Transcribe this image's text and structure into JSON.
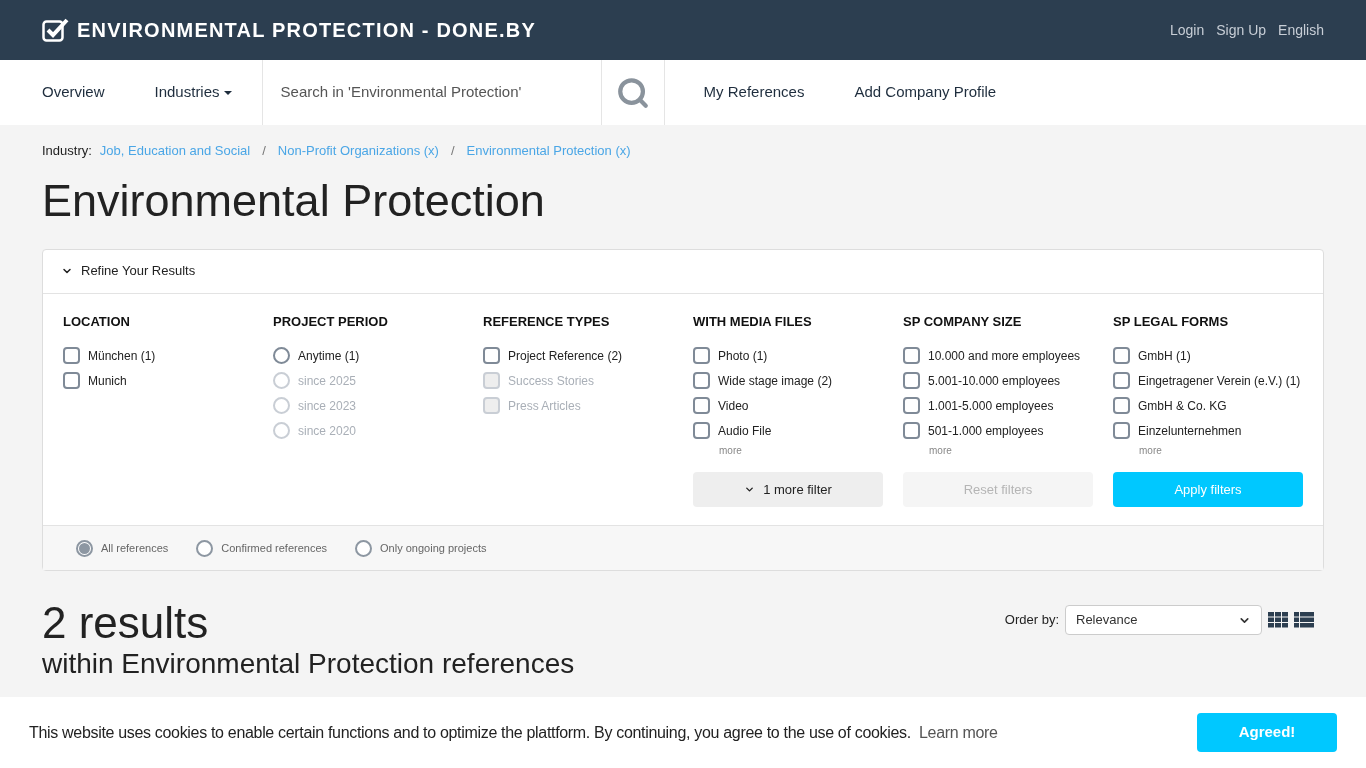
{
  "header": {
    "title": "ENVIRONMENTAL PROTECTION - DONE.BY",
    "links": [
      "Login",
      "Sign Up",
      "English"
    ]
  },
  "nav": {
    "items": [
      {
        "label": "Overview",
        "dropdown": false
      },
      {
        "label": "Industries",
        "dropdown": true
      }
    ],
    "search": {
      "placeholder": "Search in 'Environmental Protection'"
    },
    "links": [
      "My References",
      "Add Company Profile"
    ]
  },
  "breadcrumb": {
    "label": "Industry:",
    "separator": "/",
    "items": [
      "Job, Education and Social",
      "Non-Profit Organizations (x)",
      "Environmental Protection (x)"
    ]
  },
  "page_title": "Environmental Protection",
  "refine": {
    "title": "Refine Your Results",
    "expanded": true,
    "groups": [
      {
        "title": "LOCATION",
        "kind": "checkbox",
        "options": [
          {
            "label": "München (1)",
            "checked": false,
            "disabled": false
          },
          {
            "label": "Munich",
            "checked": false,
            "disabled": false
          }
        ]
      },
      {
        "title": "PROJECT PERIOD",
        "kind": "radio",
        "options": [
          {
            "label": "Anytime (1)",
            "checked": false,
            "disabled": false
          },
          {
            "label": "since 2025",
            "checked": false,
            "disabled": true
          },
          {
            "label": "since 2023",
            "checked": false,
            "disabled": true
          },
          {
            "label": "since 2020",
            "checked": false,
            "disabled": true
          }
        ]
      },
      {
        "title": "REFERENCE TYPES",
        "kind": "checkbox",
        "options": [
          {
            "label": "Project Reference (2)",
            "checked": false,
            "disabled": false
          },
          {
            "label": "Success Stories",
            "checked": false,
            "disabled": true
          },
          {
            "label": "Press Articles",
            "checked": false,
            "disabled": true
          }
        ]
      },
      {
        "title": "WITH MEDIA FILES",
        "kind": "checkbox",
        "more": "more",
        "options": [
          {
            "label": "Photo (1)",
            "checked": false,
            "disabled": false
          },
          {
            "label": "Wide stage image (2)",
            "checked": false,
            "disabled": false
          },
          {
            "label": "Video",
            "checked": false,
            "disabled": false
          },
          {
            "label": "Audio File",
            "checked": false,
            "disabled": false
          }
        ]
      },
      {
        "title": "SP COMPANY SIZE",
        "kind": "checkbox",
        "more": "more",
        "options": [
          {
            "label": "10.000 and more employees",
            "checked": false,
            "disabled": false
          },
          {
            "label": "5.001-10.000 employees",
            "checked": false,
            "disabled": false
          },
          {
            "label": "1.001-5.000 employees",
            "checked": false,
            "disabled": false
          },
          {
            "label": "501-1.000 employees",
            "checked": false,
            "disabled": false
          }
        ]
      },
      {
        "title": "SP LEGAL FORMS",
        "kind": "checkbox",
        "more": "more",
        "options": [
          {
            "label": "GmbH (1)",
            "checked": false,
            "disabled": false
          },
          {
            "label": "Eingetragener Verein (e.V.) (1)",
            "checked": false,
            "disabled": false
          },
          {
            "label": "GmbH & Co. KG",
            "checked": false,
            "disabled": false
          },
          {
            "label": "Einzelunternehmen",
            "checked": false,
            "disabled": false
          }
        ]
      }
    ],
    "buttons": [
      {
        "kind": "more",
        "label": "1 more filter"
      },
      {
        "kind": "reset",
        "label": "Reset filters",
        "disabled": true
      },
      {
        "kind": "apply",
        "label": "Apply filters"
      }
    ],
    "scope": [
      {
        "label": "All references",
        "selected": true
      },
      {
        "label": "Confirmed references",
        "selected": false
      },
      {
        "label": "Only ongoing projects",
        "selected": false
      }
    ]
  },
  "results": {
    "count": "2 results",
    "subtitle": "within Environmental Protection references",
    "order_label": "Order by:",
    "order_value": "Relevance",
    "views": [
      {
        "kind": "grid"
      },
      {
        "kind": "list"
      }
    ]
  },
  "cookie": {
    "text": "This website uses cookies to enable certain functions and to optimize the plattform. By continuing, you agree to the use of cookies.",
    "link": "Learn more",
    "button": "Agreed!"
  }
}
